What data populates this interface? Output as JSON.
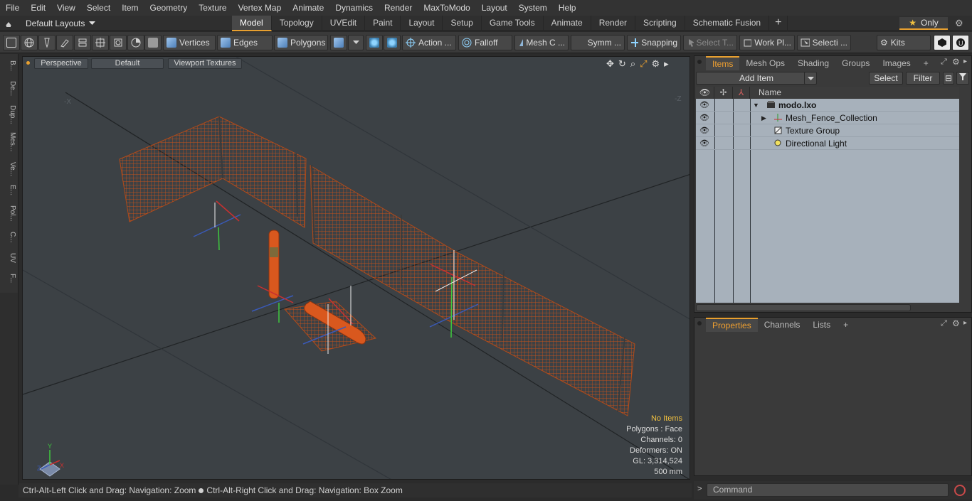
{
  "menu": [
    "File",
    "Edit",
    "View",
    "Select",
    "Item",
    "Geometry",
    "Texture",
    "Vertex Map",
    "Animate",
    "Dynamics",
    "Render",
    "MaxToModo",
    "Layout",
    "System",
    "Help"
  ],
  "layout_selector": "Default Layouts",
  "tabs": [
    "Model",
    "Topology",
    "UVEdit",
    "Paint",
    "Layout",
    "Setup",
    "Game Tools",
    "Animate",
    "Render",
    "Scripting",
    "Schematic Fusion"
  ],
  "active_tab": "Model",
  "only_label": "Only",
  "toolbar": {
    "vertices": "Vertices",
    "edges": "Edges",
    "polygons": "Polygons",
    "action": "Action ...",
    "falloff": "Falloff",
    "mesh_c": "Mesh C ...",
    "symm": "Symm ...",
    "snapping": "Snapping",
    "select_t": "Select T...",
    "work_pl": "Work Pl...",
    "selecti": "Selecti ...",
    "kits": "Kits"
  },
  "left_tabs": [
    "B...",
    "De...",
    "Dup...",
    "Mes...",
    "Ve...",
    "E...",
    "Pol...",
    "C...",
    "UV",
    "F..."
  ],
  "viewport": {
    "view_mode": "Perspective",
    "shading": "Default",
    "textures": "Viewport Textures",
    "axis_x": "X",
    "axis_y": "Y",
    "axis_z": "Z",
    "info": {
      "no_items": "No Items",
      "polygons": "Polygons : Face",
      "channels": "Channels: 0",
      "deformers": "Deformers: ON",
      "gl": "GL: 3,314,524",
      "unit": "500 mm"
    },
    "colors": {
      "fence": "#c2511c",
      "background": "#3c4145"
    }
  },
  "status_bar": {
    "left": "Ctrl-Alt-Left Click and Drag: Navigation: Zoom",
    "right": "Ctrl-Alt-Right Click and Drag: Navigation: Box Zoom"
  },
  "items_panel": {
    "tabs": [
      "Items",
      "Mesh Ops",
      "Shading",
      "Groups",
      "Images"
    ],
    "active_tab": "Items",
    "add_item": "Add Item",
    "select_btn": "Select",
    "filter_btn": "Filter",
    "column_name": "Name",
    "rows": [
      {
        "name": "modo.lxo"
      },
      {
        "name": "Mesh_Fence_Collection"
      },
      {
        "name": "Texture Group"
      },
      {
        "name": "Directional Light"
      }
    ]
  },
  "properties_panel": {
    "tabs": [
      "Properties",
      "Channels",
      "Lists"
    ],
    "active_tab": "Properties"
  },
  "command": {
    "placeholder": "Command"
  }
}
